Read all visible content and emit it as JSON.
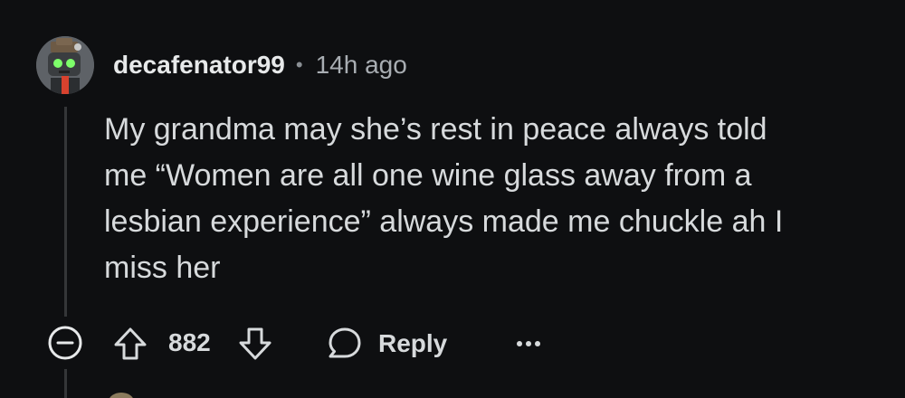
{
  "comment": {
    "username": "decafenator99",
    "separator": "•",
    "timestamp": "14h ago",
    "body_lines": [
      "My grandma may she’s rest in peace always told",
      "me “Women are all one wine glass away from a",
      "lesbian experience” always made me chuckle ah I",
      "miss her"
    ]
  },
  "actions": {
    "score": "882",
    "reply_label": "Reply",
    "icons": [
      "collapse-icon",
      "upvote-arrow-icon",
      "downvote-arrow-icon",
      "reply-bubble-icon",
      "more-options-icon"
    ]
  },
  "colors": {
    "background": "#0e0f11",
    "text_primary": "#d7dadc",
    "text_secondary": "#a8adb2",
    "thread_line": "#343638"
  }
}
